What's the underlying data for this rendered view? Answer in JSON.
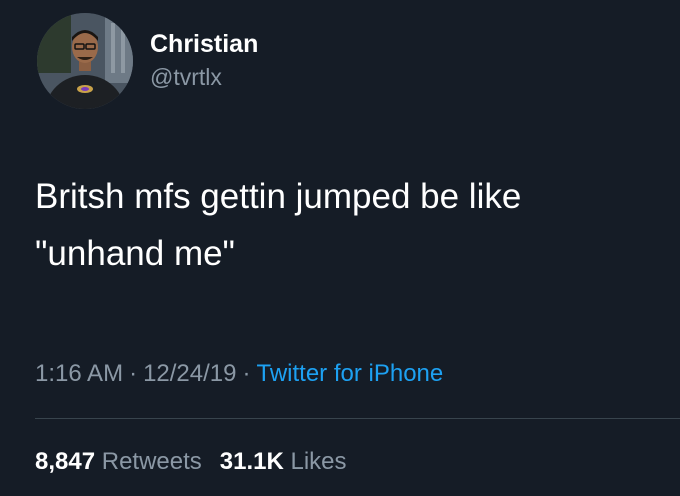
{
  "author": {
    "display_name": "Christian",
    "handle": "@tvrtlx"
  },
  "tweet": {
    "text_lines": [
      "Britsh mfs gettin jumped be like",
      "\"unhand me\""
    ]
  },
  "meta": {
    "time": "1:16 AM",
    "separator": "·",
    "date": "12/24/19",
    "source": "Twitter for iPhone"
  },
  "stats": {
    "retweets_count": "8,847",
    "retweets_label": "Retweets",
    "likes_count": "31.1K",
    "likes_label": "Likes"
  },
  "colors": {
    "background": "#151c26",
    "secondary_text": "#8b98a5",
    "link": "#1da1f2"
  }
}
